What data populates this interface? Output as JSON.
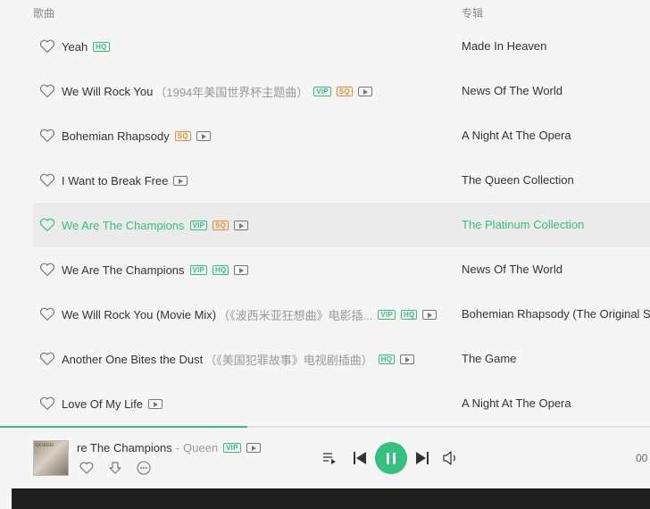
{
  "header": {
    "song_col": "歌曲",
    "album_col": "专辑"
  },
  "songs": [
    {
      "title": "Yeah",
      "subtitle": "",
      "badges": [
        "HQ"
      ],
      "mv": false,
      "album": "Made In Heaven",
      "active": false
    },
    {
      "title": "We Will Rock You",
      "subtitle": "（1994年美国世界杯主题曲）",
      "badges": [
        "VIP",
        "SQ"
      ],
      "mv": true,
      "album": "News Of The World",
      "active": false
    },
    {
      "title": "Bohemian Rhapsody",
      "subtitle": "",
      "badges": [
        "SQ"
      ],
      "mv": true,
      "album": "A Night At The Opera",
      "active": false
    },
    {
      "title": "I Want to Break Free",
      "subtitle": "",
      "badges": [],
      "mv": true,
      "album": "The Queen Collection",
      "active": false
    },
    {
      "title": "We Are The Champions",
      "subtitle": "",
      "badges": [
        "VIP",
        "SQ"
      ],
      "mv": true,
      "album": "The Platinum Collection",
      "active": true
    },
    {
      "title": "We Are The Champions",
      "subtitle": "",
      "badges": [
        "VIP",
        "HQ"
      ],
      "mv": true,
      "album": "News Of The World",
      "active": false
    },
    {
      "title": "We Will Rock You (Movie Mix)",
      "subtitle": "（《波西米亚狂想曲》电影插...",
      "badges": [
        "VIP",
        "HQ"
      ],
      "mv": true,
      "album": "Bohemian Rhapsody (The Original Soundtrack)",
      "active": false
    },
    {
      "title": "Another One Bites the Dust",
      "subtitle": "（《美国犯罪故事》电视剧插曲）",
      "badges": [
        "HQ"
      ],
      "mv": true,
      "album": "The Game",
      "active": false
    },
    {
      "title": "Love Of My Life",
      "subtitle": "",
      "badges": [],
      "mv": true,
      "album": "A Night At The Opera",
      "active": false
    }
  ],
  "player": {
    "now_title": "re The Champions",
    "separator": "-",
    "artist": "Queen",
    "badge": "VIP",
    "time": "00",
    "cover_text": "QUEEN",
    "progress": 0.38
  },
  "colors": {
    "accent": "#31c27c",
    "sq": "#ee8a2c",
    "bg": "#f5f5f5"
  }
}
